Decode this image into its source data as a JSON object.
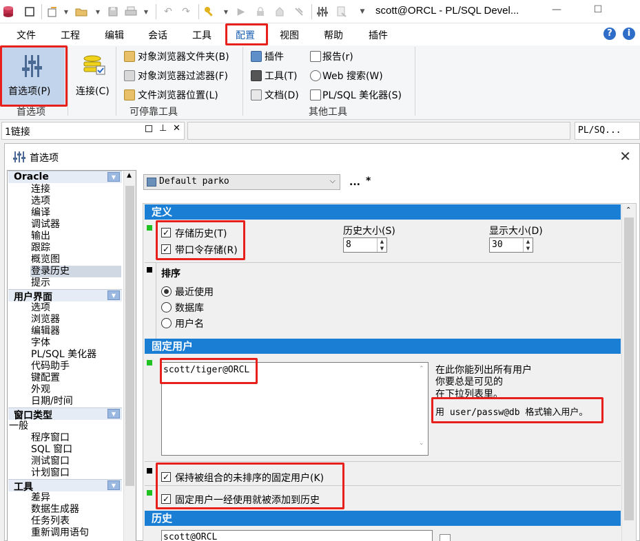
{
  "titlebar": {
    "title": "scott@ORCL - PL/SQL Devel...",
    "minimize": "—",
    "maximize": "☐"
  },
  "menu": {
    "items": [
      "文件",
      "工程",
      "编辑",
      "会话",
      "工具",
      "配置",
      "视图",
      "帮助",
      "插件"
    ],
    "active": "配置"
  },
  "ribbon": {
    "preferences_label": "首选项(P)",
    "connect_label": "连接(C)",
    "obj_browser_folders": "对象浏览器文件夹(B)",
    "obj_browser_filters": "对象浏览器过滤器(F)",
    "file_browser_locations": "文件浏览器位置(L)",
    "plugins": "插件",
    "tools": "工具(T)",
    "docs": "文档(D)",
    "reports": "报告(r)",
    "web_search": "Web 搜索(W)",
    "plsql_beautifier": "PL/SQL 美化器(S)",
    "group_preferences": "首选项",
    "group_dockable": "可停靠工具",
    "group_other": "其他工具"
  },
  "dock": {
    "left_panel_title": "1链接",
    "right_panel_title": "PL/SQ..."
  },
  "dialog": {
    "title": "首选项",
    "close": "✕",
    "profile": "Default parko",
    "more_btn": "...",
    "star": "*"
  },
  "tree": {
    "sections": [
      {
        "title": "Oracle",
        "items": [
          "连接",
          "选项",
          "编译",
          "调试器",
          "输出",
          "跟踪",
          "概览图",
          "登录历史",
          "提示"
        ]
      },
      {
        "title": "用户界面",
        "items": [
          "选项",
          "浏览器",
          "编辑器",
          "字体",
          "PL/SQL 美化器",
          "代码助手",
          "键配置",
          "外观",
          "日期/时间"
        ]
      },
      {
        "title": "窗口类型",
        "items": [
          "一般",
          "程序窗口",
          "SQL 窗口",
          "测试窗口",
          "计划窗口"
        ]
      },
      {
        "title": "工具",
        "items": [
          "差异",
          "数据生成器",
          "任务列表",
          "重新调用语句"
        ]
      }
    ],
    "selected": "登录历史"
  },
  "definition": {
    "header": "定义",
    "store_history": "存储历史(T)",
    "store_with_password": "带口令存储(R)",
    "history_size_label": "历史大小(S)",
    "history_size": "8",
    "display_size_label": "显示大小(D)",
    "display_size": "30",
    "sort_header": "排序",
    "sort_options": [
      "最近使用",
      "数据库",
      "用户名"
    ],
    "sort_selected": "最近使用"
  },
  "fixed_users": {
    "header": "固定用户",
    "users": "scott/tiger@ORCL",
    "help_line1": "在此你能列出所有用户",
    "help_line2": "你要总是可见的",
    "help_line3": "在下拉列表里。",
    "format_hint": "用 user/passw@db 格式输入用户。",
    "keep_unsorted": "保持被组合的未排序的固定用户(K)",
    "add_to_history": "固定用户一经使用就被添加到历史"
  },
  "history": {
    "header": "历史",
    "entry": "scott@ORCL"
  },
  "colors": {
    "section_header": "#1a7fd4",
    "highlight_red": "#e8201c",
    "marker_green": "#22c122",
    "marker_black": "#000000"
  }
}
